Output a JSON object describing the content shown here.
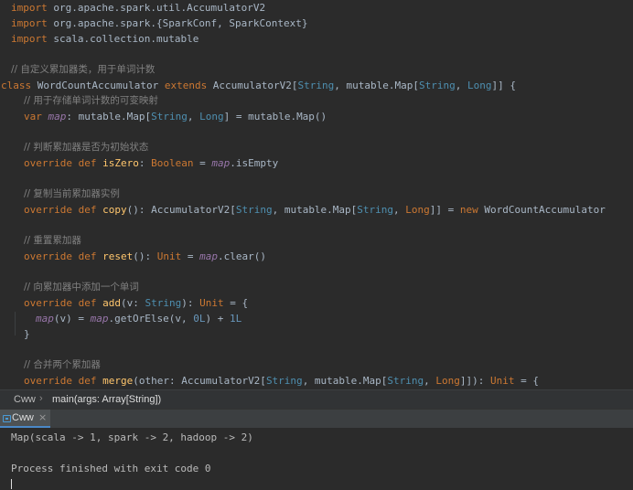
{
  "editor": {
    "line1": {
      "kw": "import",
      "rest": " org.apache.spark.util.AccumulatorV2"
    },
    "line2": {
      "kw": "import",
      "rest": " org.apache.spark.{SparkConf, SparkContext}"
    },
    "line3": {
      "kw": "import",
      "rest": " scala.collection.mutable"
    },
    "line5": {
      "comment": "// 自定义累加器类，用于单词计数"
    },
    "line6": {
      "kw1": "class",
      "name": " WordCountAccumulator ",
      "kw2": "extends",
      "p1": " AccumulatorV2[",
      "t1": "String",
      "p2": ", mutable.Map[",
      "t2": "String",
      "p3": ", ",
      "t3": "Long",
      "p4": "]] {"
    },
    "line7": {
      "comment": "// 用于存储单词计数的可变映射"
    },
    "line8": {
      "kw": "var",
      "sp": " ",
      "fld": "map",
      "p1": ": mutable.Map[",
      "t1": "String",
      "p2": ", ",
      "t2": "Long",
      "p3": "] = mutable.Map()"
    },
    "line10": {
      "comment": "// 判断累加器是否为初始状态"
    },
    "line11": {
      "kw1": "override",
      "sp1": " ",
      "kw2": "def",
      "sp2": " ",
      "fn": "isZero",
      "p1": ": ",
      "t1": "Boolean",
      "p2": " = ",
      "fld": "map",
      "p3": ".isEmpty"
    },
    "line13": {
      "comment": "// 复制当前累加器实例"
    },
    "line14": {
      "kw1": "override",
      "sp1": " ",
      "kw2": "def",
      "sp2": " ",
      "fn": "copy",
      "p1": "(): AccumulatorV2[",
      "t1": "String",
      "p2": ", mutable.Map[",
      "t2": "String",
      "p3": ", ",
      "t3": "Long",
      "p4": "]] = ",
      "kw3": "new",
      "p5": " WordCountAccumulator"
    },
    "line16": {
      "comment": "// 重置累加器"
    },
    "line17": {
      "kw1": "override",
      "sp1": " ",
      "kw2": "def",
      "sp2": " ",
      "fn": "reset",
      "p1": "(): ",
      "t1": "Unit",
      "p2": " = ",
      "fld": "map",
      "p3": ".clear()"
    },
    "line19": {
      "comment": "// 向累加器中添加一个单词"
    },
    "line20": {
      "kw1": "override",
      "sp1": " ",
      "kw2": "def",
      "sp2": " ",
      "fn": "add",
      "p1": "(v: ",
      "t1": "String",
      "p2": "): ",
      "t2": "Unit",
      "p3": " = {"
    },
    "line21": {
      "fld1": "map",
      "p1": "(v) = ",
      "fld2": "map",
      "p2": ".getOrElse(v, ",
      "n1": "0L",
      "p3": ") + ",
      "n2": "1L"
    },
    "line22": {
      "p": "}"
    },
    "line24": {
      "comment": "// 合并两个累加器"
    },
    "line25": {
      "kw1": "override",
      "sp1": " ",
      "kw2": "def",
      "sp2": " ",
      "fn": "merge",
      "p1": "(other: AccumulatorV2[",
      "t1": "String",
      "p2": ", mutable.Map[",
      "t2": "String",
      "p3": ", ",
      "t3": "Long",
      "p4": "]]): ",
      "t4": "Unit",
      "p5": " = {"
    }
  },
  "breadcrumb": {
    "object": "Cww",
    "separator": "›",
    "method": "main(args: Array[String])"
  },
  "run_panel": {
    "tab_label": "Cww",
    "tab_icon": "console-icon",
    "close_glyph": "×"
  },
  "console": {
    "output_line": "Map(scala -> 1, spark -> 2, hadoop -> 2)",
    "exit_line": "Process finished with exit code 0"
  },
  "colors": {
    "background": "#2b2b2b",
    "keyword": "#cc7832",
    "type": "#4e8fb0",
    "field": "#9876aa",
    "function": "#ffc66d",
    "number": "#6897bb",
    "comment": "#808080"
  }
}
